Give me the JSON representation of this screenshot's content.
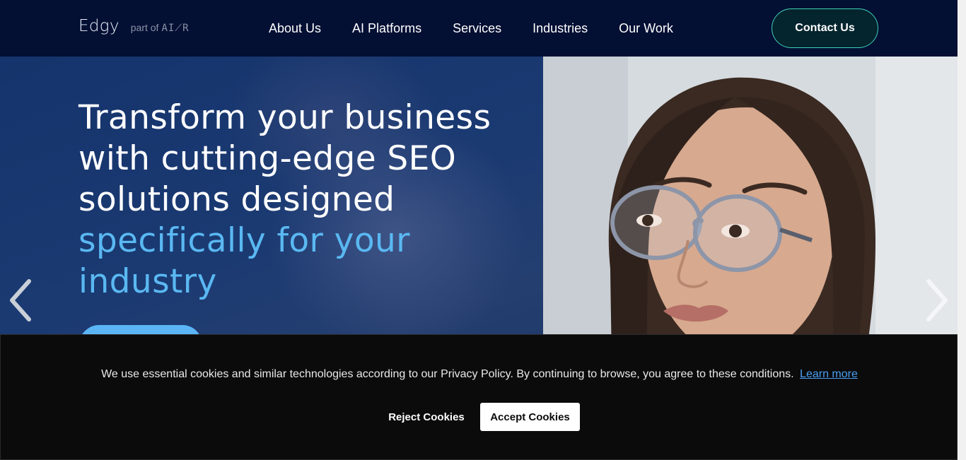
{
  "header": {
    "logo_word": "Edgy",
    "logo_part_of": "part of",
    "logo_brand": "AI⟋R",
    "nav": [
      "About Us",
      "AI Platforms",
      "Services",
      "Industries",
      "Our Work"
    ],
    "contact_label": "Contact Us"
  },
  "hero": {
    "title_lines": [
      "Transform your business",
      "with cutting-edge SEO",
      "solutions designed"
    ],
    "title_accent_lines": [
      "specifically for your",
      "industry"
    ],
    "arrow_left_icon": "chevron-left-icon",
    "arrow_right_icon": "chevron-right-icon"
  },
  "cookie": {
    "message": "We use essential cookies and similar technologies according to our Privacy Policy. By continuing to browse, you agree to these conditions.",
    "learn_more": "Learn more",
    "reject_label": "Reject Cookies",
    "accept_label": "Accept Cookies"
  },
  "colors": {
    "header_bg": "#030f33",
    "accent_blue": "#5ab8f2",
    "contact_border": "#3fd0b9",
    "cookie_bg": "#0b0b0c",
    "link_blue": "#4a9ff2"
  }
}
